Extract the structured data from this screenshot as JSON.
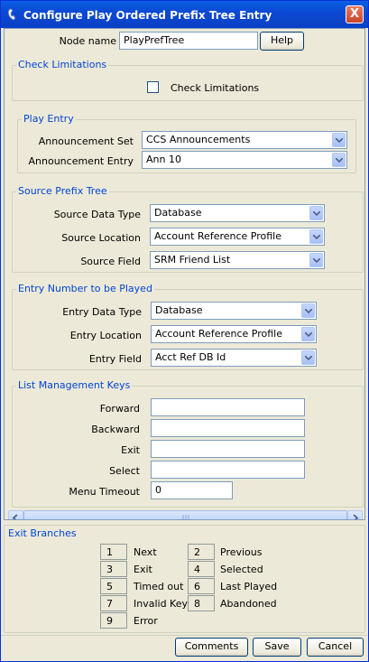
{
  "window": {
    "title": "Configure Play Ordered Prefix Tree Entry",
    "close_label": "X"
  },
  "node": {
    "label": "Node name",
    "value": "PlayPrefTree",
    "help_label": "Help"
  },
  "check_limitations": {
    "legend": "Check Limitations",
    "checkbox_label": "Check Limitations",
    "checked": false
  },
  "play_entry": {
    "legend": "Play Entry",
    "announcement_set": {
      "label": "Announcement Set",
      "value": "CCS Announcements"
    },
    "announcement_entry": {
      "label": "Announcement Entry",
      "value": "Ann 10"
    }
  },
  "source_prefix_tree": {
    "legend": "Source Prefix Tree",
    "data_type": {
      "label": "Source Data Type",
      "value": "Database"
    },
    "location": {
      "label": "Source Location",
      "value": "Account Reference Profile"
    },
    "field": {
      "label": "Source Field",
      "value": "SRM Friend List"
    }
  },
  "entry_number": {
    "legend": "Entry Number to be Played",
    "data_type": {
      "label": "Entry Data Type",
      "value": "Database"
    },
    "location": {
      "label": "Entry Location",
      "value": "Account Reference Profile"
    },
    "field": {
      "label": "Entry Field",
      "value": "Acct Ref DB Id"
    }
  },
  "list_management_keys": {
    "legend": "List Management Keys",
    "forward": {
      "label": "Forward",
      "value": ""
    },
    "backward": {
      "label": "Backward",
      "value": ""
    },
    "exit": {
      "label": "Exit",
      "value": ""
    },
    "select": {
      "label": "Select",
      "value": ""
    },
    "menu_timeout": {
      "label": "Menu Timeout",
      "value": "0"
    }
  },
  "exit_branches": {
    "legend": "Exit Branches",
    "items": [
      {
        "number": "1",
        "label": "Next"
      },
      {
        "number": "2",
        "label": "Previous"
      },
      {
        "number": "3",
        "label": "Exit"
      },
      {
        "number": "4",
        "label": "Selected"
      },
      {
        "number": "5",
        "label": "Timed out"
      },
      {
        "number": "6",
        "label": "Last Played"
      },
      {
        "number": "7",
        "label": "Invalid Key"
      },
      {
        "number": "8",
        "label": "Abandoned"
      },
      {
        "number": "9",
        "label": "Error"
      }
    ]
  },
  "footer": {
    "comments_label": "Comments",
    "save_label": "Save",
    "cancel_label": "Cancel"
  },
  "colors": {
    "title_bar": "#0a5fe3",
    "legend_text": "#0046d5",
    "background": "#ece9d8"
  }
}
